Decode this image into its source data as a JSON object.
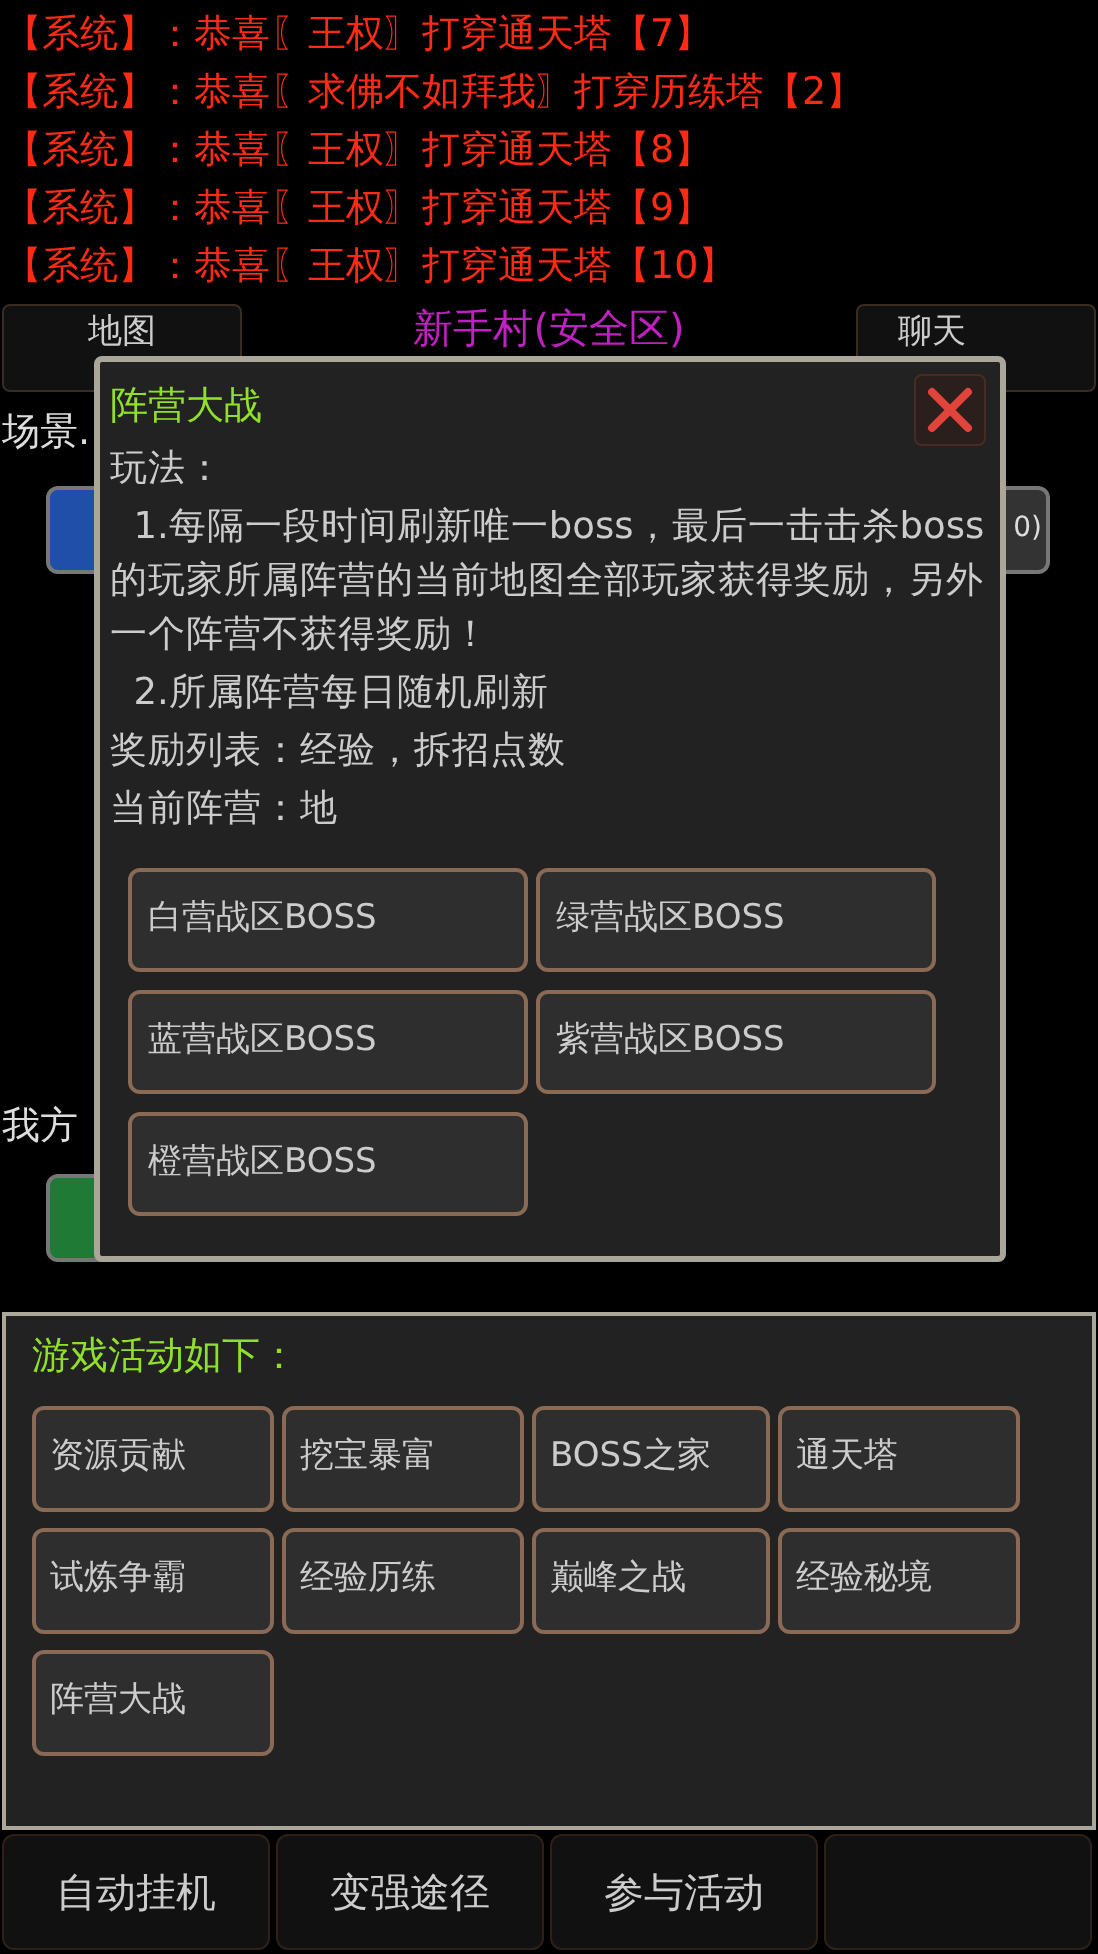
{
  "messages": [
    "【系统】：恭喜〖王权〗打穿通天塔【7】",
    "【系统】：恭喜〖求佛不如拜我〗打穿历练塔【2】",
    "【系统】：恭喜〖王权〗打穿通天塔【8】",
    "【系统】：恭喜〖王权〗打穿通天塔【9】",
    "【系统】：恭喜〖王权〗打穿通天塔【10】"
  ],
  "header": {
    "left_button": "地图",
    "title": "新手村(安全区)",
    "right_button": "聊天"
  },
  "scene": {
    "label": "场景.",
    "right_text": "0)",
    "side_label": "我方"
  },
  "dialog": {
    "title": "阵营大战",
    "lines": [
      "玩法：",
      "  1.每隔一段时间刷新唯一boss，最后一击击杀boss的玩家所属阵营的当前地图全部玩家获得奖励，另外一个阵营不获得奖励！",
      "  2.所属阵营每日随机刷新",
      "奖励列表：经验，拆招点数",
      "当前阵营：地"
    ],
    "buttons": [
      "白营战区BOSS",
      "绿营战区BOSS",
      "蓝营战区BOSS",
      "紫营战区BOSS",
      "橙营战区BOSS"
    ]
  },
  "activities": {
    "title": "游戏活动如下：",
    "buttons": [
      "资源贡献",
      "挖宝暴富",
      "BOSS之家",
      "通天塔",
      "试炼争霸",
      "经验历练",
      "巅峰之战",
      "经验秘境",
      "阵营大战"
    ]
  },
  "bottom_nav": [
    "自动挂机",
    "变强途径",
    "参与活动"
  ]
}
